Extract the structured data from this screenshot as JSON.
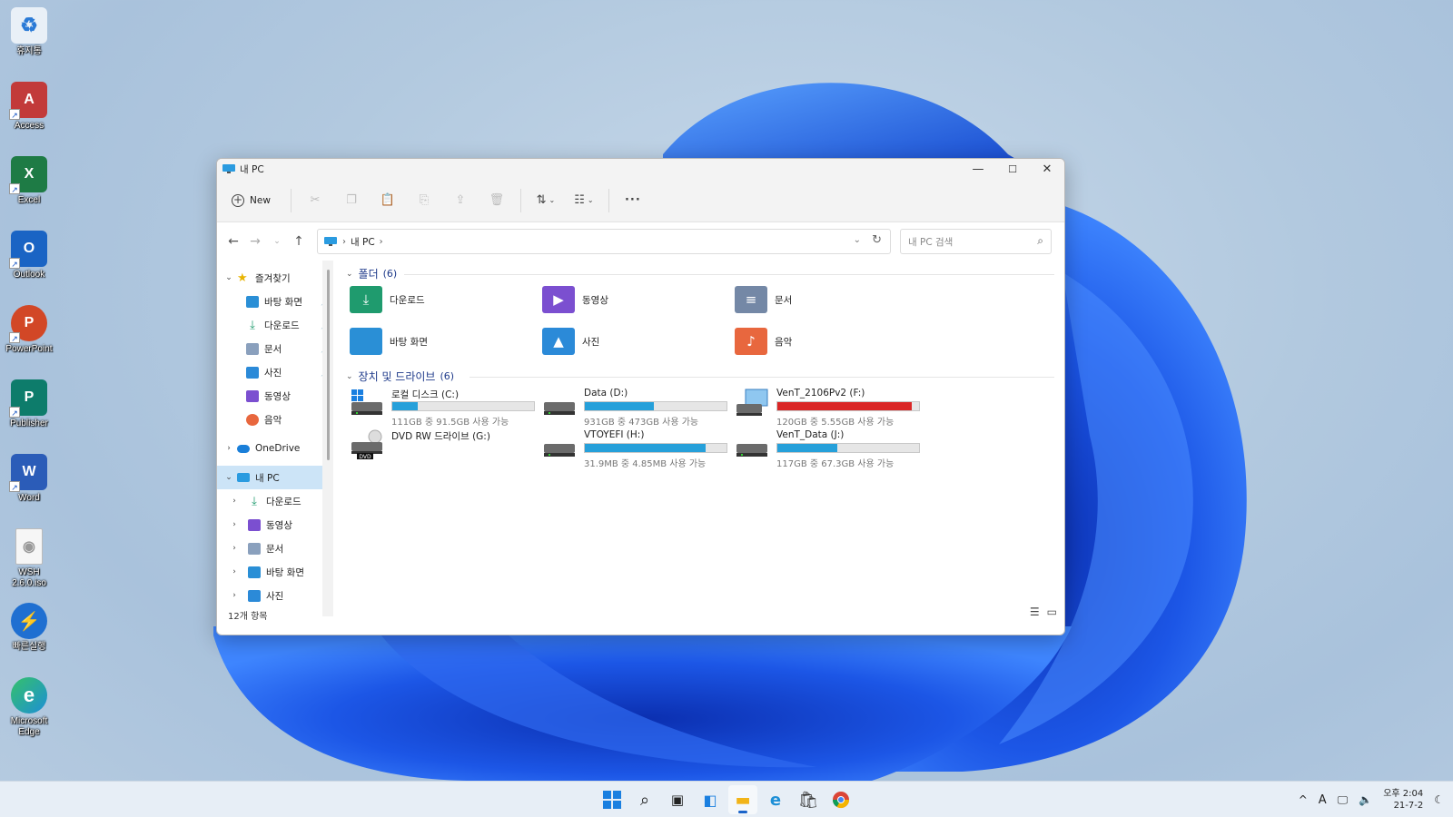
{
  "desktop": {
    "icons": [
      {
        "label": "휴지통",
        "glyph": "♻",
        "color": "#dfe8f2"
      },
      {
        "label": "Access",
        "glyph": "A",
        "color": "#c23a3a"
      },
      {
        "label": "Excel",
        "glyph": "X",
        "color": "#1e7b45"
      },
      {
        "label": "Outlook",
        "glyph": "O",
        "color": "#1a64c4"
      },
      {
        "label": "PowerPoint",
        "glyph": "P",
        "color": "#d24726"
      },
      {
        "label": "Publisher",
        "glyph": "P",
        "color": "#0d7c6b"
      },
      {
        "label": "Word",
        "glyph": "W",
        "color": "#2b5cb8"
      },
      {
        "label": "WSH 2.6.0.iso",
        "glyph": "◉",
        "color": "#f2f2f2"
      },
      {
        "label": "빠른실행",
        "glyph": "⚡",
        "color": "#1f6fd1"
      },
      {
        "label": "Microsoft Edge",
        "glyph": "e",
        "color": "#1d8fd6"
      }
    ]
  },
  "window": {
    "title": "내 PC",
    "controls": {
      "minimize": "—",
      "maximize": "☐",
      "close": "✕"
    },
    "commandbar": {
      "new_label": "New",
      "icons": [
        "cut-icon",
        "copy-icon",
        "paste-icon",
        "rename-icon",
        "share-icon",
        "delete-icon",
        "sort-icon",
        "view-icon",
        "more-icon"
      ]
    },
    "address": {
      "crumb": "내 PC",
      "search_placeholder": "내 PC 검색"
    },
    "sidebar": {
      "quick_access": "즐겨찾기",
      "quick_items": [
        "바탕 화면",
        "다운로드",
        "문서",
        "사진",
        "동영상",
        "음악"
      ],
      "onedrive": "OneDrive",
      "thispc": "내 PC",
      "pc_items": [
        "다운로드",
        "동영상",
        "문서",
        "바탕 화면",
        "사진"
      ]
    },
    "status": "12개 항목",
    "folders_group": {
      "title": "폴더",
      "count": "(6)"
    },
    "folders": [
      {
        "name": "다운로드",
        "icon": "download-folder-icon",
        "color": "#1f9b6e"
      },
      {
        "name": "동영상",
        "icon": "videos-folder-icon",
        "color": "#7b4fd0"
      },
      {
        "name": "문서",
        "icon": "documents-folder-icon",
        "color": "#7488a6"
      },
      {
        "name": "바탕 화면",
        "icon": "desktop-folder-icon",
        "color": "#2a8fd6"
      },
      {
        "name": "사진",
        "icon": "pictures-folder-icon",
        "color": "#2b8ad8"
      },
      {
        "name": "음악",
        "icon": "music-folder-icon",
        "color": "#e8673e"
      }
    ],
    "drives_group": {
      "title": "장치 및 드라이브",
      "count": "(6)"
    },
    "drives": [
      {
        "name": "로컬 디스크 (C:)",
        "free": "111GB 중 91.5GB 사용 가능",
        "used_fraction": 0.18,
        "bar_color": "#26a0da",
        "icon": "windows-drive-icon"
      },
      {
        "name": "Data (D:)",
        "free": "931GB 중 473GB 사용 가능",
        "used_fraction": 0.49,
        "bar_color": "#26a0da",
        "icon": "hdd-icon"
      },
      {
        "name": "VenT_2106Pv2 (F:)",
        "free": "120GB 중 5.55GB 사용 가능",
        "used_fraction": 0.95,
        "bar_color": "#da2626",
        "icon": "network-drive-icon"
      },
      {
        "name": "DVD RW 드라이브 (G:)",
        "free": "",
        "used_fraction": null,
        "bar_color": "",
        "icon": "dvd-drive-icon"
      },
      {
        "name": "VTOYEFI (H:)",
        "free": "31.9MB 중 4.85MB 사용 가능",
        "used_fraction": 0.85,
        "bar_color": "#26a0da",
        "icon": "hdd-icon"
      },
      {
        "name": "VenT_Data (J:)",
        "free": "117GB 중 67.3GB 사용 가능",
        "used_fraction": 0.42,
        "bar_color": "#26a0da",
        "icon": "hdd-icon"
      }
    ]
  },
  "taskbar": {
    "apps": [
      "start-icon",
      "search-icon",
      "task-view-icon",
      "widgets-icon",
      "file-explorer-icon",
      "edge-icon",
      "store-icon",
      "chrome-icon"
    ],
    "tray": {
      "chevron": "^",
      "ime": "A",
      "time": "오후 2:04",
      "date": "21-7-2"
    }
  }
}
